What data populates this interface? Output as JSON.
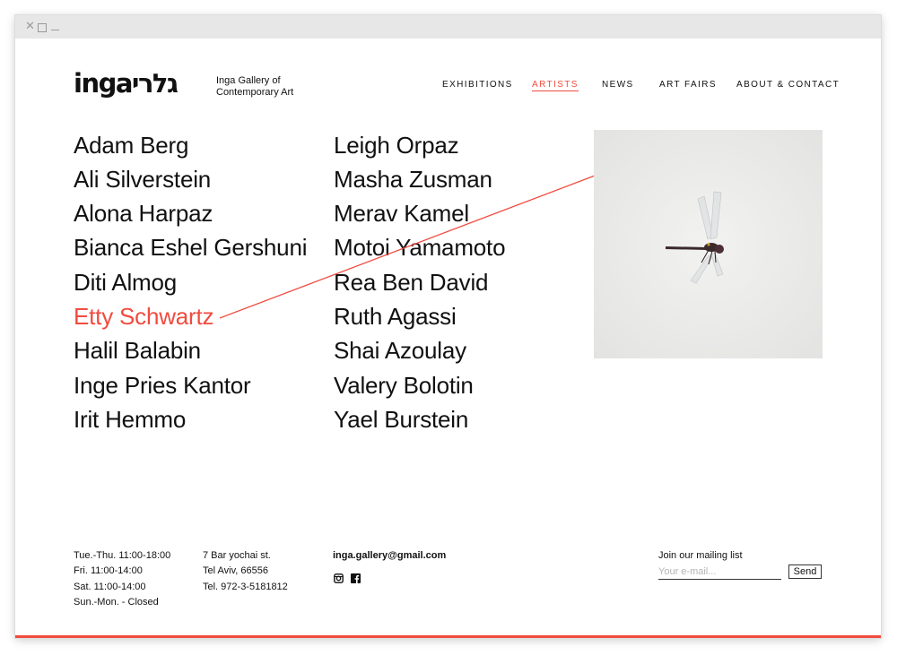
{
  "logo": {
    "wordmark": "ingaגלרי",
    "tagline_line1": "Inga Gallery of",
    "tagline_line2": "Contemporary Art"
  },
  "nav": [
    {
      "label": "EXHIBITIONS",
      "active": false
    },
    {
      "label": "ARTISTS",
      "active": true
    },
    {
      "label": "NEWS",
      "active": false
    },
    {
      "label": "ART FAIRS",
      "active": false
    },
    {
      "label": "ABOUT & CONTACT",
      "active": false
    }
  ],
  "artists": {
    "column1": [
      "Adam Berg",
      "Ali Silverstein",
      "Alona Harpaz",
      "Bianca Eshel Gershuni",
      "Diti Almog",
      "Etty Schwartz",
      "Halil Balabin",
      "Inge Pries Kantor",
      "Irit Hemmo"
    ],
    "column2": [
      "Leigh Orpaz",
      "Masha Zusman",
      "Merav Kamel",
      "Motoi Yamamoto",
      "Rea Ben David",
      "Ruth Agassi",
      "Shai Azoulay",
      "Valery Bolotin",
      "Yael Burstein"
    ],
    "hovered": "Etty Schwartz"
  },
  "footer": {
    "hours": [
      "Tue.-Thu. 11:00-18:00",
      "Fri. 11:00-14:00",
      "Sat. 11:00-14:00",
      "Sun.-Mon. - Closed"
    ],
    "address": [
      "7 Bar yochai st.",
      "Tel Aviv, 66556",
      "Tel. 972-3-5181812"
    ],
    "email": "inga.gallery@gmail.com",
    "social_icons": [
      "instagram-icon",
      "facebook-icon"
    ],
    "mailing": {
      "label": "Join our mailing list",
      "placeholder": "Your e-mail...",
      "button": "Send"
    }
  },
  "colors": {
    "accent": "#f14b3f",
    "text": "#111111",
    "chrome": "#e7e7e7"
  }
}
